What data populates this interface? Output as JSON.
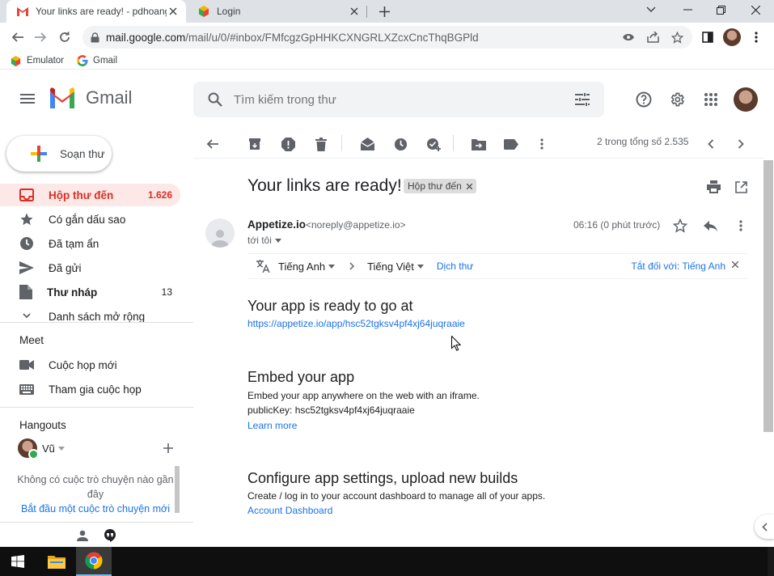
{
  "browser": {
    "tabs": [
      {
        "title": "Your links are ready! - pdhoangvu",
        "active": true
      },
      {
        "title": "Login",
        "active": false
      }
    ],
    "url_host": "mail.google.com",
    "url_path": "/mail/u/0/#inbox/FMfcgzGpHHKCXNGRLXZcxCncThqBGPld",
    "bookmarks": [
      {
        "label": "Emulator",
        "icon": "cube-icon"
      },
      {
        "label": "Gmail",
        "icon": "google-g-icon"
      }
    ]
  },
  "gmail": {
    "logo_text": "Gmail",
    "search_placeholder": "Tìm kiếm trong thư"
  },
  "sidebar": {
    "compose_label": "Soạn thư",
    "items": [
      {
        "label": "Hộp thư đến",
        "count": "1.626",
        "icon": "inbox-icon",
        "active": true
      },
      {
        "label": "Có gắn dấu sao",
        "count": "",
        "icon": "star-icon"
      },
      {
        "label": "Đã tạm ẩn",
        "count": "",
        "icon": "clock-icon"
      },
      {
        "label": "Đã gửi",
        "count": "",
        "icon": "send-icon"
      },
      {
        "label": "Thư nháp",
        "count": "13",
        "icon": "draft-icon",
        "bold": true
      },
      {
        "label": "Danh sách mở rộng",
        "count": "",
        "icon": "chevron-down-icon"
      }
    ],
    "meet": {
      "title": "Meet",
      "items": [
        {
          "label": "Cuộc họp mới",
          "icon": "videocam-icon"
        },
        {
          "label": "Tham gia cuộc họp",
          "icon": "keyboard-icon"
        }
      ]
    },
    "hangouts": {
      "title": "Hangouts",
      "user": "Vũ",
      "empty_text": "Không có cuộc trò chuyện nào gần đây",
      "start_link": "Bắt đầu một cuộc trò chuyện mới"
    }
  },
  "toolbar": {
    "pager": "2 trong tổng số 2.535"
  },
  "email": {
    "subject": "Your links are ready!",
    "label_chip": "Hộp thư đến",
    "sender_name": "Appetize.io",
    "sender_email": "<noreply@appetize.io>",
    "to": "tới tôi",
    "time": "06:16 (0 phút trước)",
    "translate": {
      "from_lang": "Tiếng Anh",
      "to_lang": "Tiếng Việt",
      "translate_link": "Dịch thư",
      "turn_off": "Tắt đối với: Tiếng Anh"
    },
    "sections": [
      {
        "heading": "Your app is ready to go at",
        "link": "https://appetize.io/app/hsc52tgksv4pf4xj64juqraaie"
      },
      {
        "heading": "Embed your app",
        "line1": "Embed your app anywhere on the web with an iframe.",
        "line2": "publicKey: hsc52tgksv4pf4xj64juqraaie",
        "link": "Learn more"
      },
      {
        "heading": "Configure app settings, upload new builds",
        "line1": "Create / log in to your account dashboard to manage all of your apps.",
        "link": "Account Dashboard"
      }
    ]
  },
  "colors": {
    "gmail_red": "#d93025",
    "link_blue": "#1a73e8",
    "active_nav_bg": "#fce8e6"
  }
}
